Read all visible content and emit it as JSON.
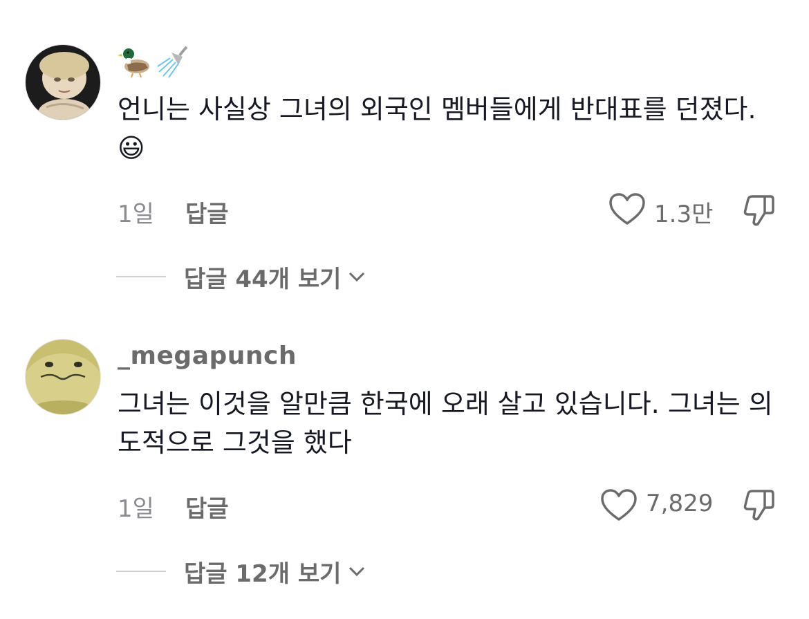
{
  "comments": [
    {
      "username": "",
      "username_icons": [
        "duck-emoji-icon",
        "shower-emoji-icon"
      ],
      "text": "언니는 사실상 그녀의 외국인 멤버들에게 반대표를 던졌다. 😃",
      "time": "1일",
      "reply_label": "답글",
      "likes": "1.3만",
      "view_replies": "답글 44개 보기"
    },
    {
      "username": "_megapunch",
      "text": "그녀는 이것을 알만큼 한국에 오래 살고 있습니다. 그녀는 의도적으로 그것을 했다",
      "time": "1일",
      "reply_label": "답글",
      "likes": "7,829",
      "view_replies": "답글 12개 보기"
    }
  ],
  "colors": {
    "text_primary": "#161823",
    "text_secondary": "#6b6b6b",
    "text_tertiary": "#8a8b91",
    "divider": "#d0d0d3"
  }
}
